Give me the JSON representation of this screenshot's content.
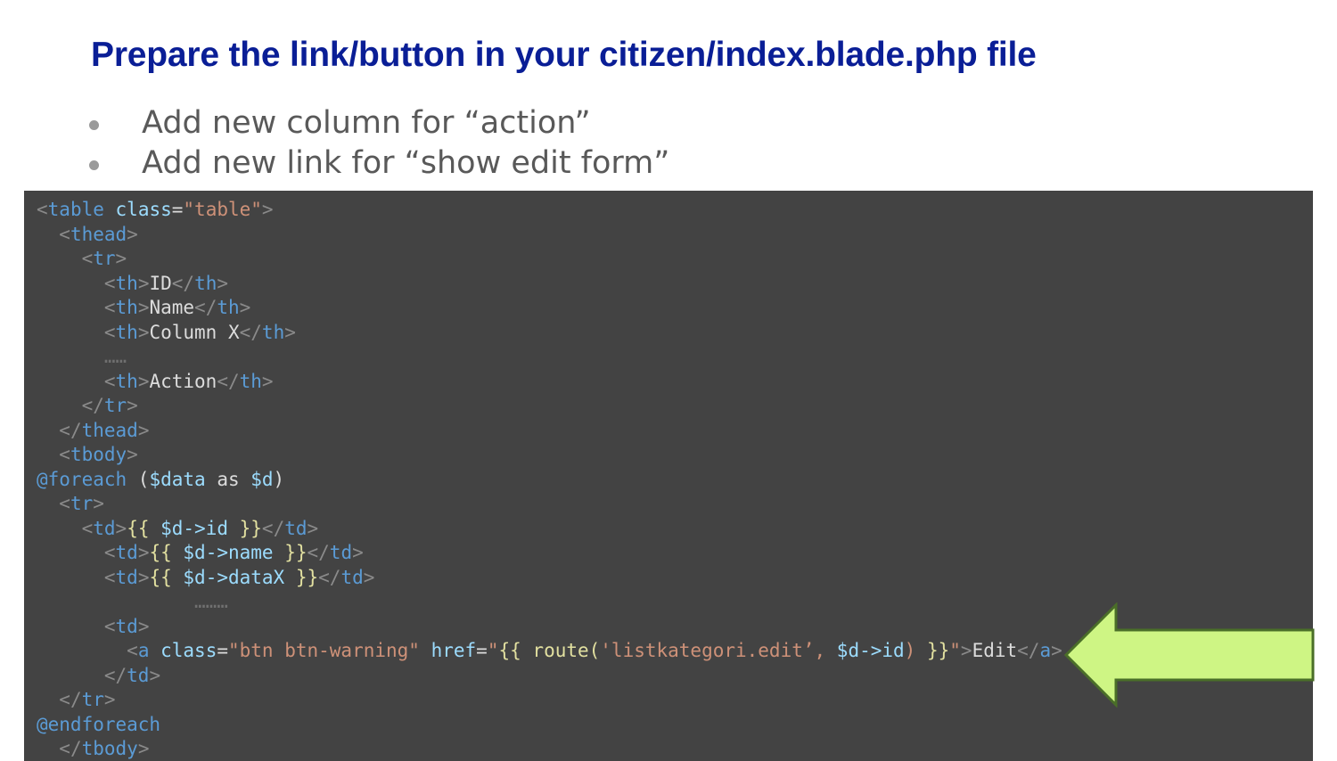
{
  "slide": {
    "title": "Prepare the link/button in your citizen/index.blade.php file",
    "bullets": [
      "Add new column for “action”",
      "Add new link for “show edit form”"
    ]
  },
  "code": {
    "table_tag": "table",
    "class_attr": "class",
    "table_class": "\"table\"",
    "thead": "thead",
    "tr": "tr",
    "th": "th",
    "th_id": "ID",
    "th_name": "Name",
    "th_colx": "Column X",
    "ellipsis1": "……",
    "th_action": "Action",
    "tbody": "tbody",
    "foreach": "@foreach",
    "foreach_open": " (",
    "var_data": "$data",
    "as_kw": " as ",
    "var_d": "$d",
    "foreach_close": ")",
    "td": "td",
    "blade_open": "{{ ",
    "blade_close": " }}",
    "expr_id": "$d->id",
    "expr_name": "$d->name",
    "expr_datax": "$d->dataX",
    "ellipsis2": "………",
    "a_tag": "a",
    "a_class_val": "\"btn btn-warning\"",
    "href_attr": "href",
    "href_q": "\"",
    "route_fn": "route(",
    "route_arg": "'listkategori.edit’, ",
    "route_var": "$d->id",
    "route_close": ")",
    "link_text": "Edit",
    "endforeach": "@endforeach"
  },
  "colors": {
    "title": "#0a1e96",
    "code_bg": "#434343",
    "arrow_fill": "#cef584",
    "arrow_stroke": "#4a6e28"
  }
}
